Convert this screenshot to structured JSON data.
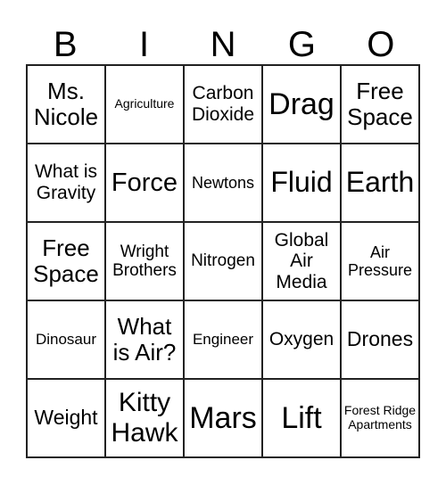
{
  "header": [
    "B",
    "I",
    "N",
    "G",
    "O"
  ],
  "cells": [
    {
      "text": "Ms. Nicole",
      "size": 26
    },
    {
      "text": "Agriculture",
      "size": 14
    },
    {
      "text": "Carbon Dioxide",
      "size": 21
    },
    {
      "text": "Drag",
      "size": 34
    },
    {
      "text": "Free Space",
      "size": 26
    },
    {
      "text": "What is Gravity",
      "size": 21
    },
    {
      "text": "Force",
      "size": 29
    },
    {
      "text": "Newtons",
      "size": 18
    },
    {
      "text": "Fluid",
      "size": 32
    },
    {
      "text": "Earth",
      "size": 32
    },
    {
      "text": "Free Space",
      "size": 26
    },
    {
      "text": "Wright Brothers",
      "size": 19
    },
    {
      "text": "Nitrogen",
      "size": 19
    },
    {
      "text": "Global Air Media",
      "size": 21
    },
    {
      "text": "Air Pressure",
      "size": 18
    },
    {
      "text": "Dinosaur",
      "size": 17
    },
    {
      "text": "What is Air?",
      "size": 26
    },
    {
      "text": "Engineer",
      "size": 17
    },
    {
      "text": "Oxygen",
      "size": 21
    },
    {
      "text": "Drones",
      "size": 23
    },
    {
      "text": "Weight",
      "size": 23
    },
    {
      "text": "Kitty Hawk",
      "size": 30
    },
    {
      "text": "Mars",
      "size": 34
    },
    {
      "text": "Lift",
      "size": 34
    },
    {
      "text": "Forest Ridge Apartments",
      "size": 14
    }
  ]
}
